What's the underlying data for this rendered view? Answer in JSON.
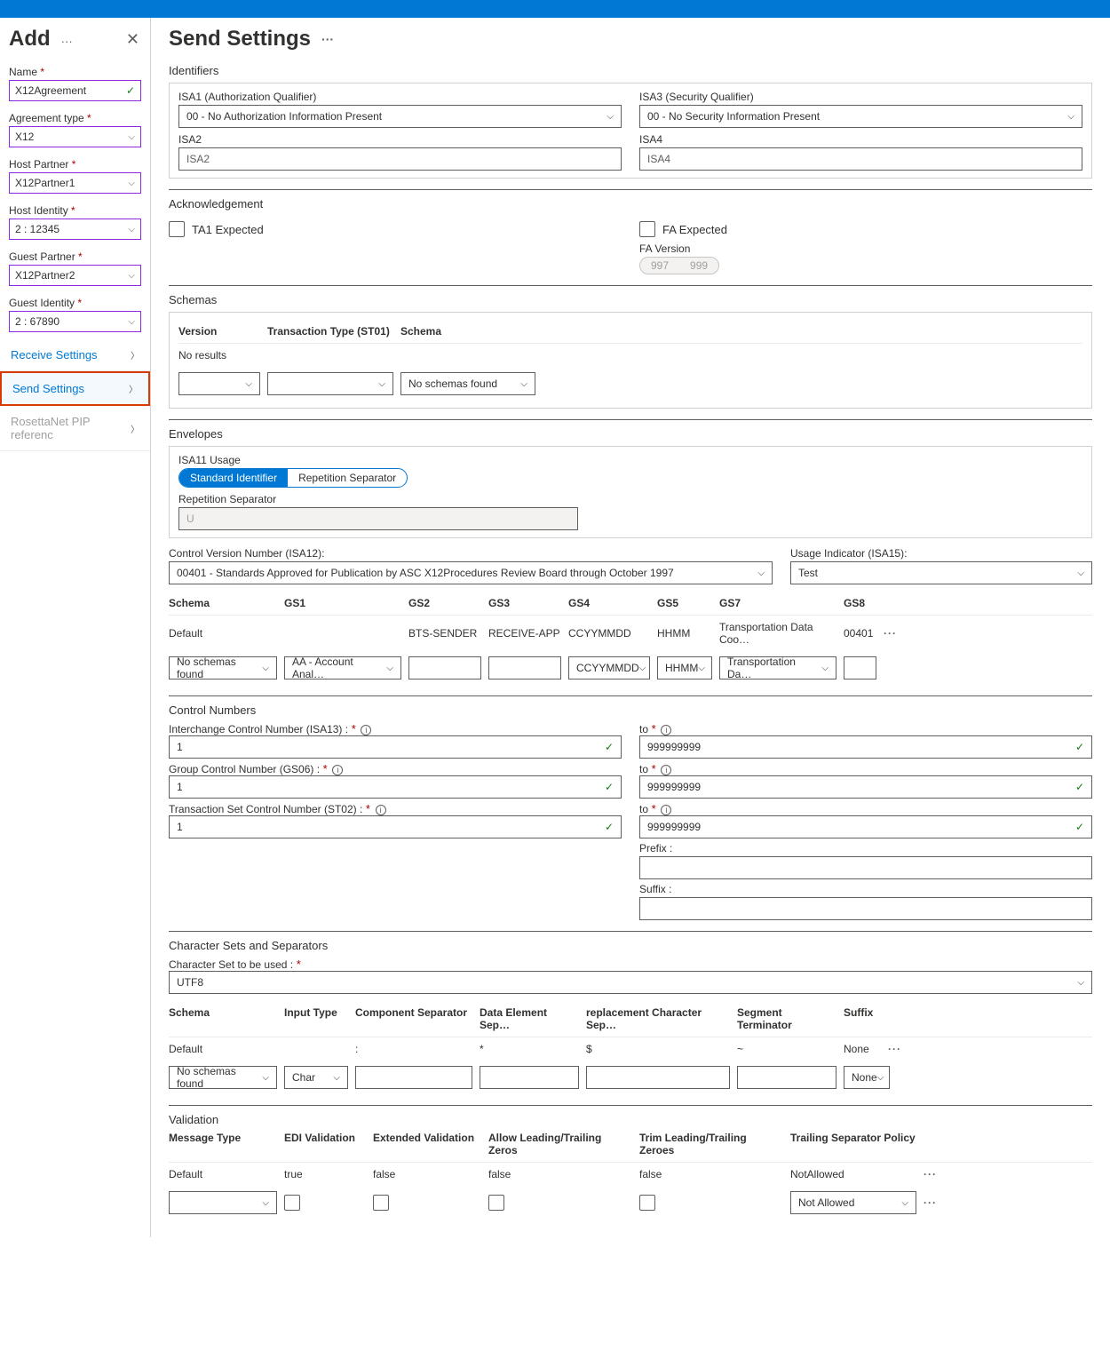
{
  "sidebar": {
    "title": "Add",
    "fields": {
      "name": {
        "label": "Name",
        "value": "X12Agreement"
      },
      "agreement_type": {
        "label": "Agreement type",
        "value": "X12"
      },
      "host_partner": {
        "label": "Host Partner",
        "value": "X12Partner1"
      },
      "host_identity": {
        "label": "Host Identity",
        "value": "2 : 12345"
      },
      "guest_partner": {
        "label": "Guest Partner",
        "value": "X12Partner2"
      },
      "guest_identity": {
        "label": "Guest Identity",
        "value": "2 : 67890"
      }
    },
    "nav": {
      "receive": "Receive Settings",
      "send": "Send Settings",
      "rosetta": "RosettaNet PIP referenc"
    }
  },
  "main": {
    "title": "Send Settings",
    "identifiers": {
      "label": "Identifiers",
      "isa1_label": "ISA1 (Authorization Qualifier)",
      "isa1_value": "00 - No Authorization Information Present",
      "isa3_label": "ISA3 (Security Qualifier)",
      "isa3_value": "00 - No Security Information Present",
      "isa2_label": "ISA2",
      "isa2_placeholder": "ISA2",
      "isa4_label": "ISA4",
      "isa4_placeholder": "ISA4"
    },
    "ack": {
      "label": "Acknowledgement",
      "ta1": "TA1 Expected",
      "fa": "FA Expected",
      "fa_version": "FA Version",
      "v997": "997",
      "v999": "999"
    },
    "schemas": {
      "label": "Schemas",
      "version": "Version",
      "tx_type": "Transaction Type (ST01)",
      "schema": "Schema",
      "no_results": "No results",
      "no_schemas": "No schemas found"
    },
    "envelopes": {
      "label": "Envelopes",
      "isa11": "ISA11 Usage",
      "std": "Standard Identifier",
      "rep": "Repetition Separator",
      "rep_label": "Repetition Separator",
      "rep_value": "U",
      "cvn_label": "Control Version Number (ISA12):",
      "cvn_value": "00401 - Standards Approved for Publication by ASC X12Procedures Review Board through October 1997",
      "usage_label": "Usage Indicator (ISA15):",
      "usage_value": "Test",
      "cols": {
        "schema": "Schema",
        "gs1": "GS1",
        "gs2": "GS2",
        "gs3": "GS3",
        "gs4": "GS4",
        "gs5": "GS5",
        "gs7": "GS7",
        "gs8": "GS8"
      },
      "default_row": {
        "schema": "Default",
        "gs2": "BTS-SENDER",
        "gs3": "RECEIVE-APP",
        "gs4": "CCYYMMDD",
        "gs5": "HHMM",
        "gs7": "Transportation Data Coo…",
        "gs8": "00401"
      },
      "input_row": {
        "schema": "No schemas found",
        "gs1": "AA - Account Anal…",
        "gs4": "CCYYMMDD",
        "gs5": "HHMM",
        "gs7": "Transportation Da…"
      }
    },
    "control": {
      "label": "Control Numbers",
      "isa13": "Interchange Control Number (ISA13) :",
      "gs06": "Group Control Number (GS06) :",
      "st02": "Transaction Set Control Number (ST02) :",
      "to": "to",
      "one": "1",
      "nines": "999999999",
      "prefix": "Prefix :",
      "suffix": "Suffix :"
    },
    "charset": {
      "label": "Character Sets and Separators",
      "cs_label": "Character Set to be used :",
      "cs_value": "UTF8",
      "cols": {
        "schema": "Schema",
        "input": "Input Type",
        "comp": "Component Separator",
        "elem": "Data Element Sep…",
        "repl": "replacement Character Sep…",
        "seg": "Segment Terminator",
        "suf": "Suffix"
      },
      "default_row": {
        "schema": "Default",
        "comp": ":",
        "elem": "*",
        "repl": "$",
        "seg": "~",
        "suf": "None"
      },
      "input_row": {
        "schema": "No schemas found",
        "input": "Char",
        "suf": "None"
      }
    },
    "validation": {
      "label": "Validation",
      "cols": {
        "msg": "Message Type",
        "edi": "EDI Validation",
        "ext": "Extended Validation",
        "lead": "Allow Leading/Trailing Zeros",
        "trim": "Trim Leading/Trailing Zeroes",
        "trail": "Trailing Separator Policy"
      },
      "default_row": {
        "msg": "Default",
        "edi": "true",
        "ext": "false",
        "lead": "false",
        "trim": "false",
        "trail": "NotAllowed"
      },
      "input_row": {
        "trail": "Not Allowed"
      }
    }
  }
}
